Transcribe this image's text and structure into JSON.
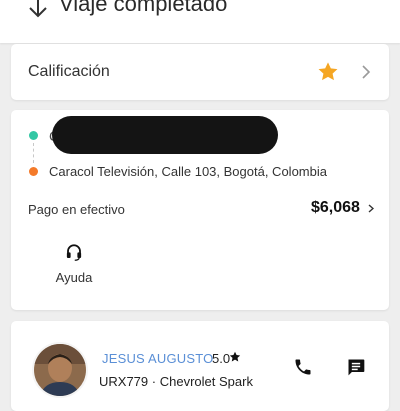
{
  "header": {
    "title": "Viaje completado",
    "back_icon": "arrow-down-icon"
  },
  "rating_row": {
    "label": "Calificación",
    "icon": "star-icon",
    "accent": "#f5a623"
  },
  "trip": {
    "pickup_visible": "C",
    "dropoff_address": "Caracol Televisión, Calle 103, Bogotá, Colombia",
    "payment_method": "Pago en efectivo",
    "price": "$6,068",
    "help_label": "Ayuda",
    "pickup_color": "#33c7a4",
    "dropoff_color": "#f47a2a"
  },
  "driver": {
    "name": "JESUS AUGUSTO",
    "rating": "5.0",
    "plate": "URX779",
    "separator": "·",
    "vehicle": "Chevrolet Spark",
    "name_color": "#5a8fd6"
  }
}
